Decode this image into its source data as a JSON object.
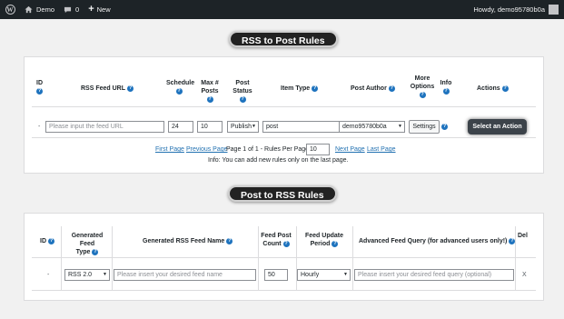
{
  "adminbar": {
    "site_name": "Demo",
    "comments_count": "0",
    "new_label": "New",
    "howdy": "Howdy, demo95780b0a"
  },
  "rss_to_post": {
    "title": "RSS to Post Rules",
    "headers": {
      "id": "ID",
      "feed_url": "RSS Feed URL",
      "schedule": "Schedule",
      "max_posts_1": "Max #",
      "max_posts_2": "Posts",
      "post_status": "Post Status",
      "item_type": "Item Type",
      "post_author": "Post Author",
      "more_options_1": "More",
      "more_options_2": "Options",
      "info": "Info",
      "actions": "Actions"
    },
    "row": {
      "id": "-",
      "feed_url_placeholder": "Please input the feed URL",
      "schedule": "24",
      "max_posts": "10",
      "post_status": "Publish",
      "item_type": "post",
      "post_author": "demo95780b0a",
      "settings_label": "Settings",
      "action_label": "Select an Action"
    },
    "pagination": {
      "first": "First Page",
      "previous": "Previous Page",
      "page_info": "Page 1 of 1 - Rules Per Page:",
      "per_page": "10",
      "next": "Next Page",
      "last": "Last Page"
    },
    "info_note": "Info: You can add new rules only on the last page."
  },
  "post_to_rss": {
    "title": "Post to RSS Rules",
    "headers": {
      "id": "ID",
      "feed_type_1": "Generated Feed",
      "feed_type_2": "Type",
      "feed_name": "Generated RSS Feed Name",
      "post_count_1": "Feed Post",
      "post_count_2": "Count",
      "update_period_1": "Feed Update",
      "update_period_2": "Period",
      "advanced_query": "Advanced Feed Query (for advanced users only!)",
      "delete": "Del"
    },
    "row": {
      "id": "-",
      "feed_type": "RSS 2.0",
      "feed_name_placeholder": "Please insert your desired feed name",
      "post_count": "50",
      "update_period": "Hourly",
      "query_placeholder": "Please insert your desired feed query (optional)",
      "delete": "X"
    }
  },
  "help_glyph": "?",
  "colors": {
    "adminbar": "#1d2327",
    "help": "#1e73be",
    "link": "#2271b1",
    "pill": "#222222"
  }
}
